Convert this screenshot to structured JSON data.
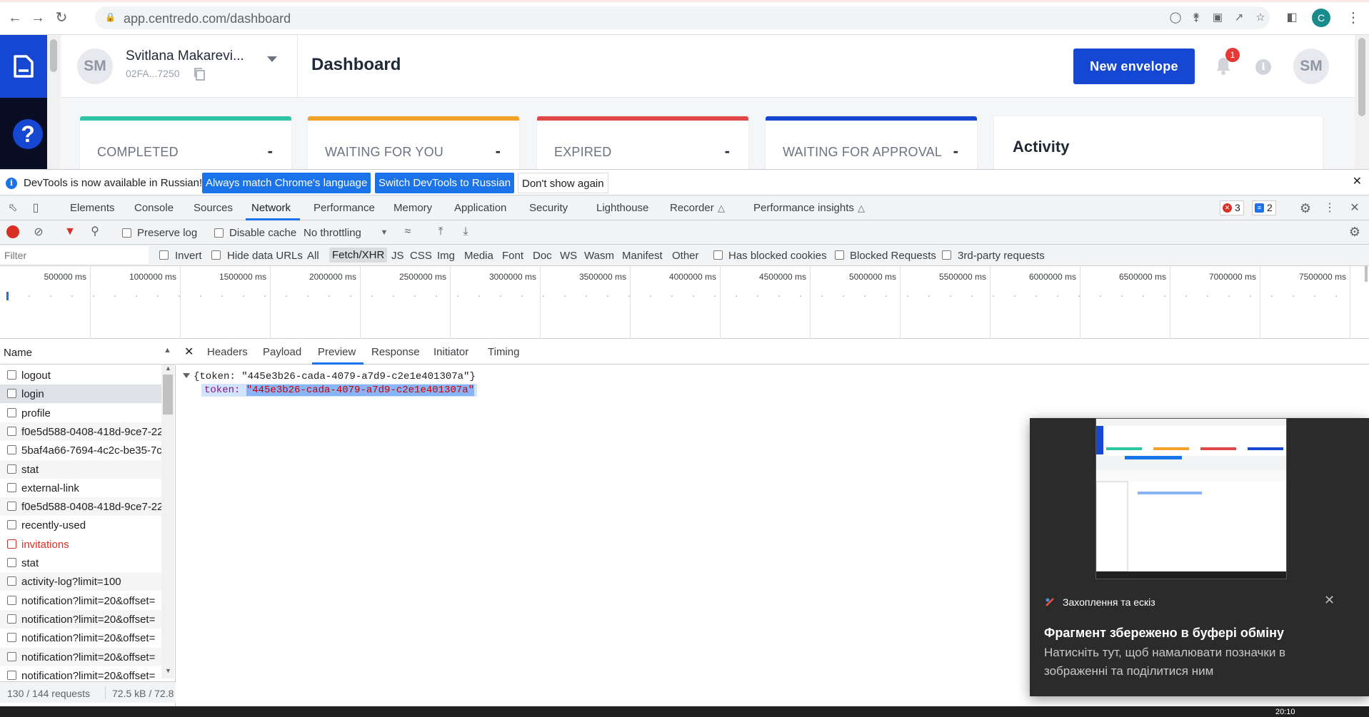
{
  "browser": {
    "url": "app.centredo.com/dashboard",
    "profile_initial": "C"
  },
  "app": {
    "user": {
      "initials": "SM",
      "name": "Svitlana Makarevi...",
      "id": "02FA...7250"
    },
    "page_title": "Dashboard",
    "new_envelope_label": "New envelope",
    "notification_count": "1",
    "info_icon_label": "i",
    "avatar_initials": "SM",
    "help_label": "?",
    "stat_cards": [
      {
        "label": "COMPLETED",
        "value": "-",
        "color": "#2ec4a6"
      },
      {
        "label": "WAITING FOR YOU",
        "value": "-",
        "color": "#f2a229"
      },
      {
        "label": "EXPIRED",
        "value": "-",
        "color": "#e04848"
      },
      {
        "label": "WAITING FOR APPROVAL",
        "value": "-",
        "color": "#1547d2"
      }
    ],
    "activity_title": "Activity"
  },
  "devtools": {
    "infobar": {
      "message": "DevTools is now available in Russian!",
      "btn_match": "Always match Chrome's language",
      "btn_switch": "Switch DevTools to Russian",
      "btn_dismiss": "Don't show again"
    },
    "tabs": [
      "Elements",
      "Console",
      "Sources",
      "Network",
      "Performance",
      "Memory",
      "Application",
      "Security",
      "Lighthouse",
      "Recorder",
      "Performance insights"
    ],
    "active_tab": "Network",
    "error_count": "3",
    "message_count": "2",
    "toolbar": {
      "preserve_log": "Preserve log",
      "disable_cache": "Disable cache",
      "throttling": "No throttling"
    },
    "filter": {
      "placeholder": "Filter",
      "invert": "Invert",
      "hide_data_urls": "Hide data URLs",
      "types": [
        "All",
        "Fetch/XHR",
        "JS",
        "CSS",
        "Img",
        "Media",
        "Font",
        "Doc",
        "WS",
        "Wasm",
        "Manifest",
        "Other"
      ],
      "selected_type": "Fetch/XHR",
      "has_blocked_cookies": "Has blocked cookies",
      "blocked_requests": "Blocked Requests",
      "third_party": "3rd-party requests"
    },
    "timeline_ticks": [
      "500000 ms",
      "1000000 ms",
      "1500000 ms",
      "2000000 ms",
      "2500000 ms",
      "3000000 ms",
      "3500000 ms",
      "4000000 ms",
      "4500000 ms",
      "5000000 ms",
      "5500000 ms",
      "6000000 ms",
      "6500000 ms",
      "7000000 ms",
      "7500000 ms"
    ],
    "requests_header": "Name",
    "requests": [
      {
        "name": "logout",
        "state": "normal"
      },
      {
        "name": "login",
        "state": "selected"
      },
      {
        "name": "profile",
        "state": "normal"
      },
      {
        "name": "f0e5d588-0408-418d-9ce7-22",
        "state": "alt"
      },
      {
        "name": "5baf4a66-7694-4c2c-be35-7c",
        "state": "normal"
      },
      {
        "name": "stat",
        "state": "alt"
      },
      {
        "name": "external-link",
        "state": "normal"
      },
      {
        "name": "f0e5d588-0408-418d-9ce7-22",
        "state": "alt"
      },
      {
        "name": "recently-used",
        "state": "normal"
      },
      {
        "name": "invitations",
        "state": "error"
      },
      {
        "name": "stat",
        "state": "normal"
      },
      {
        "name": "activity-log?limit=100",
        "state": "alt"
      },
      {
        "name": "notification?limit=20&offset=",
        "state": "normal"
      },
      {
        "name": "notification?limit=20&offset=",
        "state": "alt"
      },
      {
        "name": "notification?limit=20&offset=",
        "state": "normal"
      },
      {
        "name": "notification?limit=20&offset=",
        "state": "alt"
      },
      {
        "name": "notification?limit=20&offset=",
        "state": "normal"
      }
    ],
    "status": {
      "requests": "130 / 144 requests",
      "transferred": "72.5 kB / 72.8"
    },
    "detail_tabs": [
      "Headers",
      "Payload",
      "Preview",
      "Response",
      "Initiator",
      "Timing"
    ],
    "active_detail_tab": "Preview",
    "preview": {
      "summary": "{token: \"445e3b26-cada-4079-a7d9-c2e1e401307a\"}",
      "key": "token: ",
      "value": "\"445e3b26-cada-4079-a7d9-c2e1e401307a\""
    }
  },
  "toast": {
    "app_name": "Захоплення та ескіз",
    "title": "Фрагмент збережено в буфері обміну",
    "body": "Натисніть тут, щоб намалювати позначки в зображенні та поділитися ним"
  },
  "taskbar": {
    "time": "20:10"
  }
}
